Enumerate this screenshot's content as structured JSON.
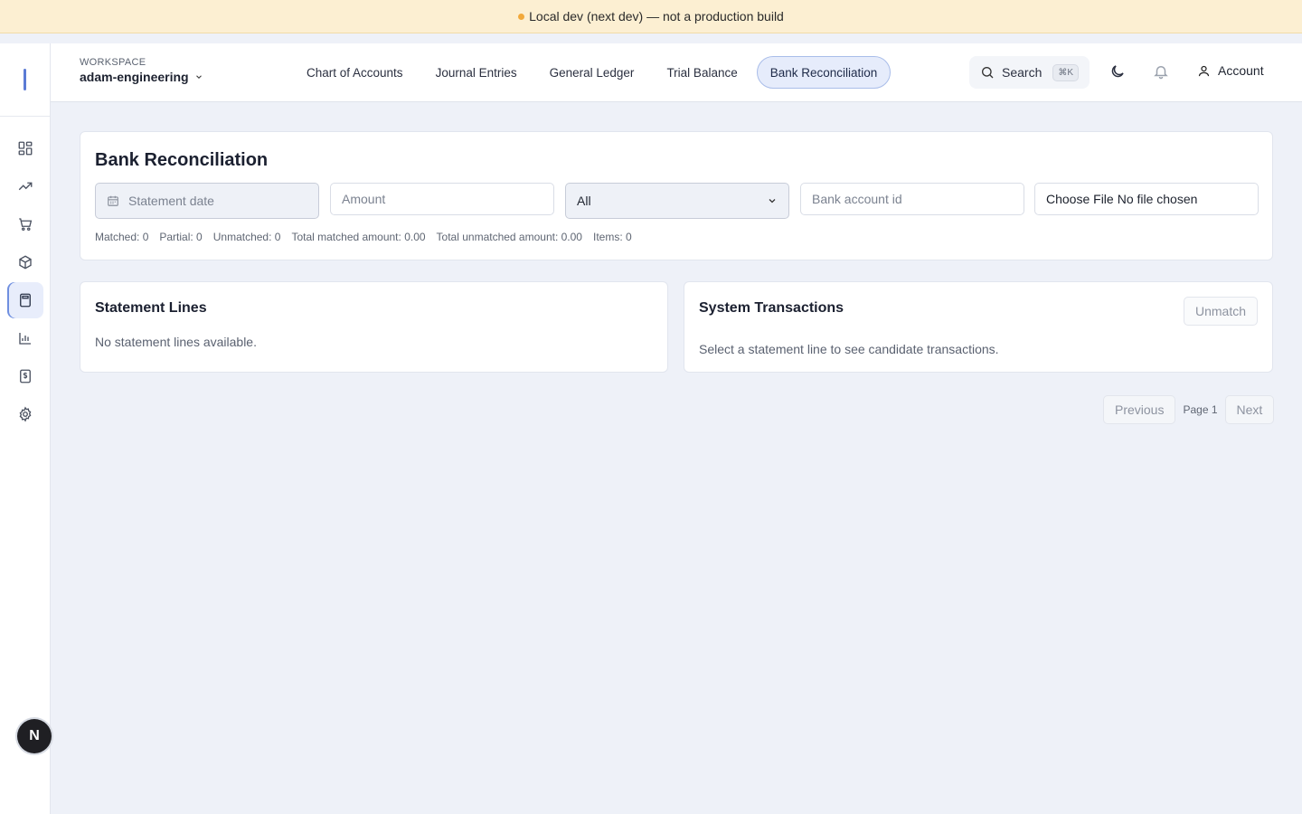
{
  "banner": {
    "text": "Local dev (next dev) — not a production build",
    "dot_color": "#f2a93b"
  },
  "sidebar": {
    "items": [
      {
        "name": "dashboard-icon"
      },
      {
        "name": "trending-up-icon"
      },
      {
        "name": "cart-icon"
      },
      {
        "name": "package-icon"
      },
      {
        "name": "calculator-icon",
        "active": true
      },
      {
        "name": "bar-chart-icon"
      },
      {
        "name": "dollar-receipt-icon"
      },
      {
        "name": "gear-icon"
      }
    ],
    "avatar_letter": "N"
  },
  "topbar": {
    "workspace_label": "WORKSPACE",
    "workspace_name": "adam-engineering",
    "tabs": [
      {
        "label": "Chart of Accounts"
      },
      {
        "label": "Journal Entries"
      },
      {
        "label": "General Ledger"
      },
      {
        "label": "Trial Balance"
      },
      {
        "label": "Bank Reconciliation",
        "active": true
      }
    ],
    "search_label": "Search",
    "search_shortcut": "⌘K",
    "account_label": "Account"
  },
  "recon": {
    "title": "Bank Reconciliation",
    "date_placeholder": "Statement date",
    "amount_placeholder": "Amount",
    "status_selected": "All",
    "bank_placeholder": "Bank account id",
    "file_button": "Choose File",
    "file_status": "No file chosen",
    "stats": {
      "matched": "Matched: 0",
      "partial": "Partial: 0",
      "unmatched": "Unmatched: 0",
      "total_matched": "Total matched amount: 0.00",
      "total_unmatched": "Total unmatched amount: 0.00",
      "items": "Items: 0"
    }
  },
  "statement_lines": {
    "title": "Statement Lines",
    "empty": "No statement lines available."
  },
  "system_transactions": {
    "title": "System Transactions",
    "unmatch_label": "Unmatch",
    "empty": "Select a statement line to see candidate transactions."
  },
  "pager": {
    "previous": "Previous",
    "page": "Page 1",
    "next": "Next"
  },
  "colors": {
    "accent": "#6f8fe0",
    "background": "#eef1f8",
    "banner": "#fcefd2"
  }
}
